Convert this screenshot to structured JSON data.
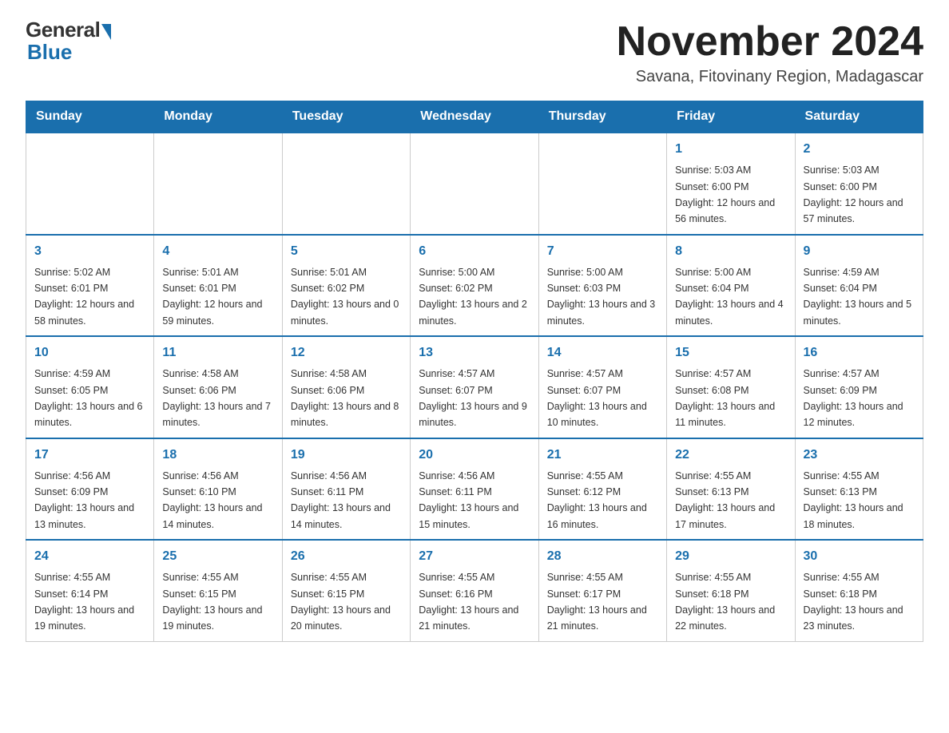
{
  "header": {
    "logo_general": "General",
    "logo_blue": "Blue",
    "month_title": "November 2024",
    "subtitle": "Savana, Fitovinany Region, Madagascar"
  },
  "weekdays": [
    "Sunday",
    "Monday",
    "Tuesday",
    "Wednesday",
    "Thursday",
    "Friday",
    "Saturday"
  ],
  "weeks": [
    [
      {
        "day": "",
        "info": ""
      },
      {
        "day": "",
        "info": ""
      },
      {
        "day": "",
        "info": ""
      },
      {
        "day": "",
        "info": ""
      },
      {
        "day": "",
        "info": ""
      },
      {
        "day": "1",
        "info": "Sunrise: 5:03 AM\nSunset: 6:00 PM\nDaylight: 12 hours\nand 56 minutes."
      },
      {
        "day": "2",
        "info": "Sunrise: 5:03 AM\nSunset: 6:00 PM\nDaylight: 12 hours\nand 57 minutes."
      }
    ],
    [
      {
        "day": "3",
        "info": "Sunrise: 5:02 AM\nSunset: 6:01 PM\nDaylight: 12 hours\nand 58 minutes."
      },
      {
        "day": "4",
        "info": "Sunrise: 5:01 AM\nSunset: 6:01 PM\nDaylight: 12 hours\nand 59 minutes."
      },
      {
        "day": "5",
        "info": "Sunrise: 5:01 AM\nSunset: 6:02 PM\nDaylight: 13 hours\nand 0 minutes."
      },
      {
        "day": "6",
        "info": "Sunrise: 5:00 AM\nSunset: 6:02 PM\nDaylight: 13 hours\nand 2 minutes."
      },
      {
        "day": "7",
        "info": "Sunrise: 5:00 AM\nSunset: 6:03 PM\nDaylight: 13 hours\nand 3 minutes."
      },
      {
        "day": "8",
        "info": "Sunrise: 5:00 AM\nSunset: 6:04 PM\nDaylight: 13 hours\nand 4 minutes."
      },
      {
        "day": "9",
        "info": "Sunrise: 4:59 AM\nSunset: 6:04 PM\nDaylight: 13 hours\nand 5 minutes."
      }
    ],
    [
      {
        "day": "10",
        "info": "Sunrise: 4:59 AM\nSunset: 6:05 PM\nDaylight: 13 hours\nand 6 minutes."
      },
      {
        "day": "11",
        "info": "Sunrise: 4:58 AM\nSunset: 6:06 PM\nDaylight: 13 hours\nand 7 minutes."
      },
      {
        "day": "12",
        "info": "Sunrise: 4:58 AM\nSunset: 6:06 PM\nDaylight: 13 hours\nand 8 minutes."
      },
      {
        "day": "13",
        "info": "Sunrise: 4:57 AM\nSunset: 6:07 PM\nDaylight: 13 hours\nand 9 minutes."
      },
      {
        "day": "14",
        "info": "Sunrise: 4:57 AM\nSunset: 6:07 PM\nDaylight: 13 hours\nand 10 minutes."
      },
      {
        "day": "15",
        "info": "Sunrise: 4:57 AM\nSunset: 6:08 PM\nDaylight: 13 hours\nand 11 minutes."
      },
      {
        "day": "16",
        "info": "Sunrise: 4:57 AM\nSunset: 6:09 PM\nDaylight: 13 hours\nand 12 minutes."
      }
    ],
    [
      {
        "day": "17",
        "info": "Sunrise: 4:56 AM\nSunset: 6:09 PM\nDaylight: 13 hours\nand 13 minutes."
      },
      {
        "day": "18",
        "info": "Sunrise: 4:56 AM\nSunset: 6:10 PM\nDaylight: 13 hours\nand 14 minutes."
      },
      {
        "day": "19",
        "info": "Sunrise: 4:56 AM\nSunset: 6:11 PM\nDaylight: 13 hours\nand 14 minutes."
      },
      {
        "day": "20",
        "info": "Sunrise: 4:56 AM\nSunset: 6:11 PM\nDaylight: 13 hours\nand 15 minutes."
      },
      {
        "day": "21",
        "info": "Sunrise: 4:55 AM\nSunset: 6:12 PM\nDaylight: 13 hours\nand 16 minutes."
      },
      {
        "day": "22",
        "info": "Sunrise: 4:55 AM\nSunset: 6:13 PM\nDaylight: 13 hours\nand 17 minutes."
      },
      {
        "day": "23",
        "info": "Sunrise: 4:55 AM\nSunset: 6:13 PM\nDaylight: 13 hours\nand 18 minutes."
      }
    ],
    [
      {
        "day": "24",
        "info": "Sunrise: 4:55 AM\nSunset: 6:14 PM\nDaylight: 13 hours\nand 19 minutes."
      },
      {
        "day": "25",
        "info": "Sunrise: 4:55 AM\nSunset: 6:15 PM\nDaylight: 13 hours\nand 19 minutes."
      },
      {
        "day": "26",
        "info": "Sunrise: 4:55 AM\nSunset: 6:15 PM\nDaylight: 13 hours\nand 20 minutes."
      },
      {
        "day": "27",
        "info": "Sunrise: 4:55 AM\nSunset: 6:16 PM\nDaylight: 13 hours\nand 21 minutes."
      },
      {
        "day": "28",
        "info": "Sunrise: 4:55 AM\nSunset: 6:17 PM\nDaylight: 13 hours\nand 21 minutes."
      },
      {
        "day": "29",
        "info": "Sunrise: 4:55 AM\nSunset: 6:18 PM\nDaylight: 13 hours\nand 22 minutes."
      },
      {
        "day": "30",
        "info": "Sunrise: 4:55 AM\nSunset: 6:18 PM\nDaylight: 13 hours\nand 23 minutes."
      }
    ]
  ]
}
